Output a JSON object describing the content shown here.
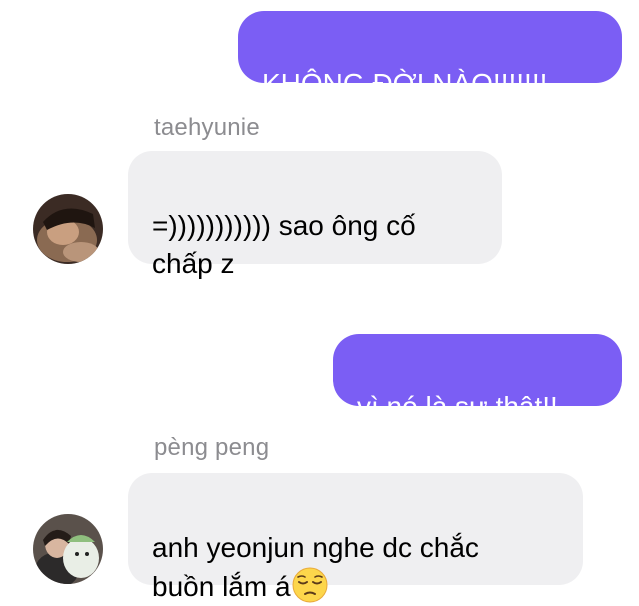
{
  "messages": [
    {
      "direction": "outgoing",
      "text": "KHÔNG ĐỜI NÀO!!!!!!!"
    },
    {
      "direction": "incoming",
      "sender": "taehyunie",
      "text": "=))))))))))) sao ông cố\nchấp z"
    },
    {
      "direction": "outgoing",
      "text": "vì nó là sự thật!!"
    },
    {
      "direction": "incoming",
      "sender": "pèng peng",
      "text": "anh yeonjun nghe dc chắc\nbuồn lắm á",
      "emoji": "pensive-face"
    }
  ],
  "colors": {
    "outgoing_bubble": "#7b5ef4",
    "incoming_bubble": "#efeff1",
    "sender_name": "#8c8c90"
  }
}
